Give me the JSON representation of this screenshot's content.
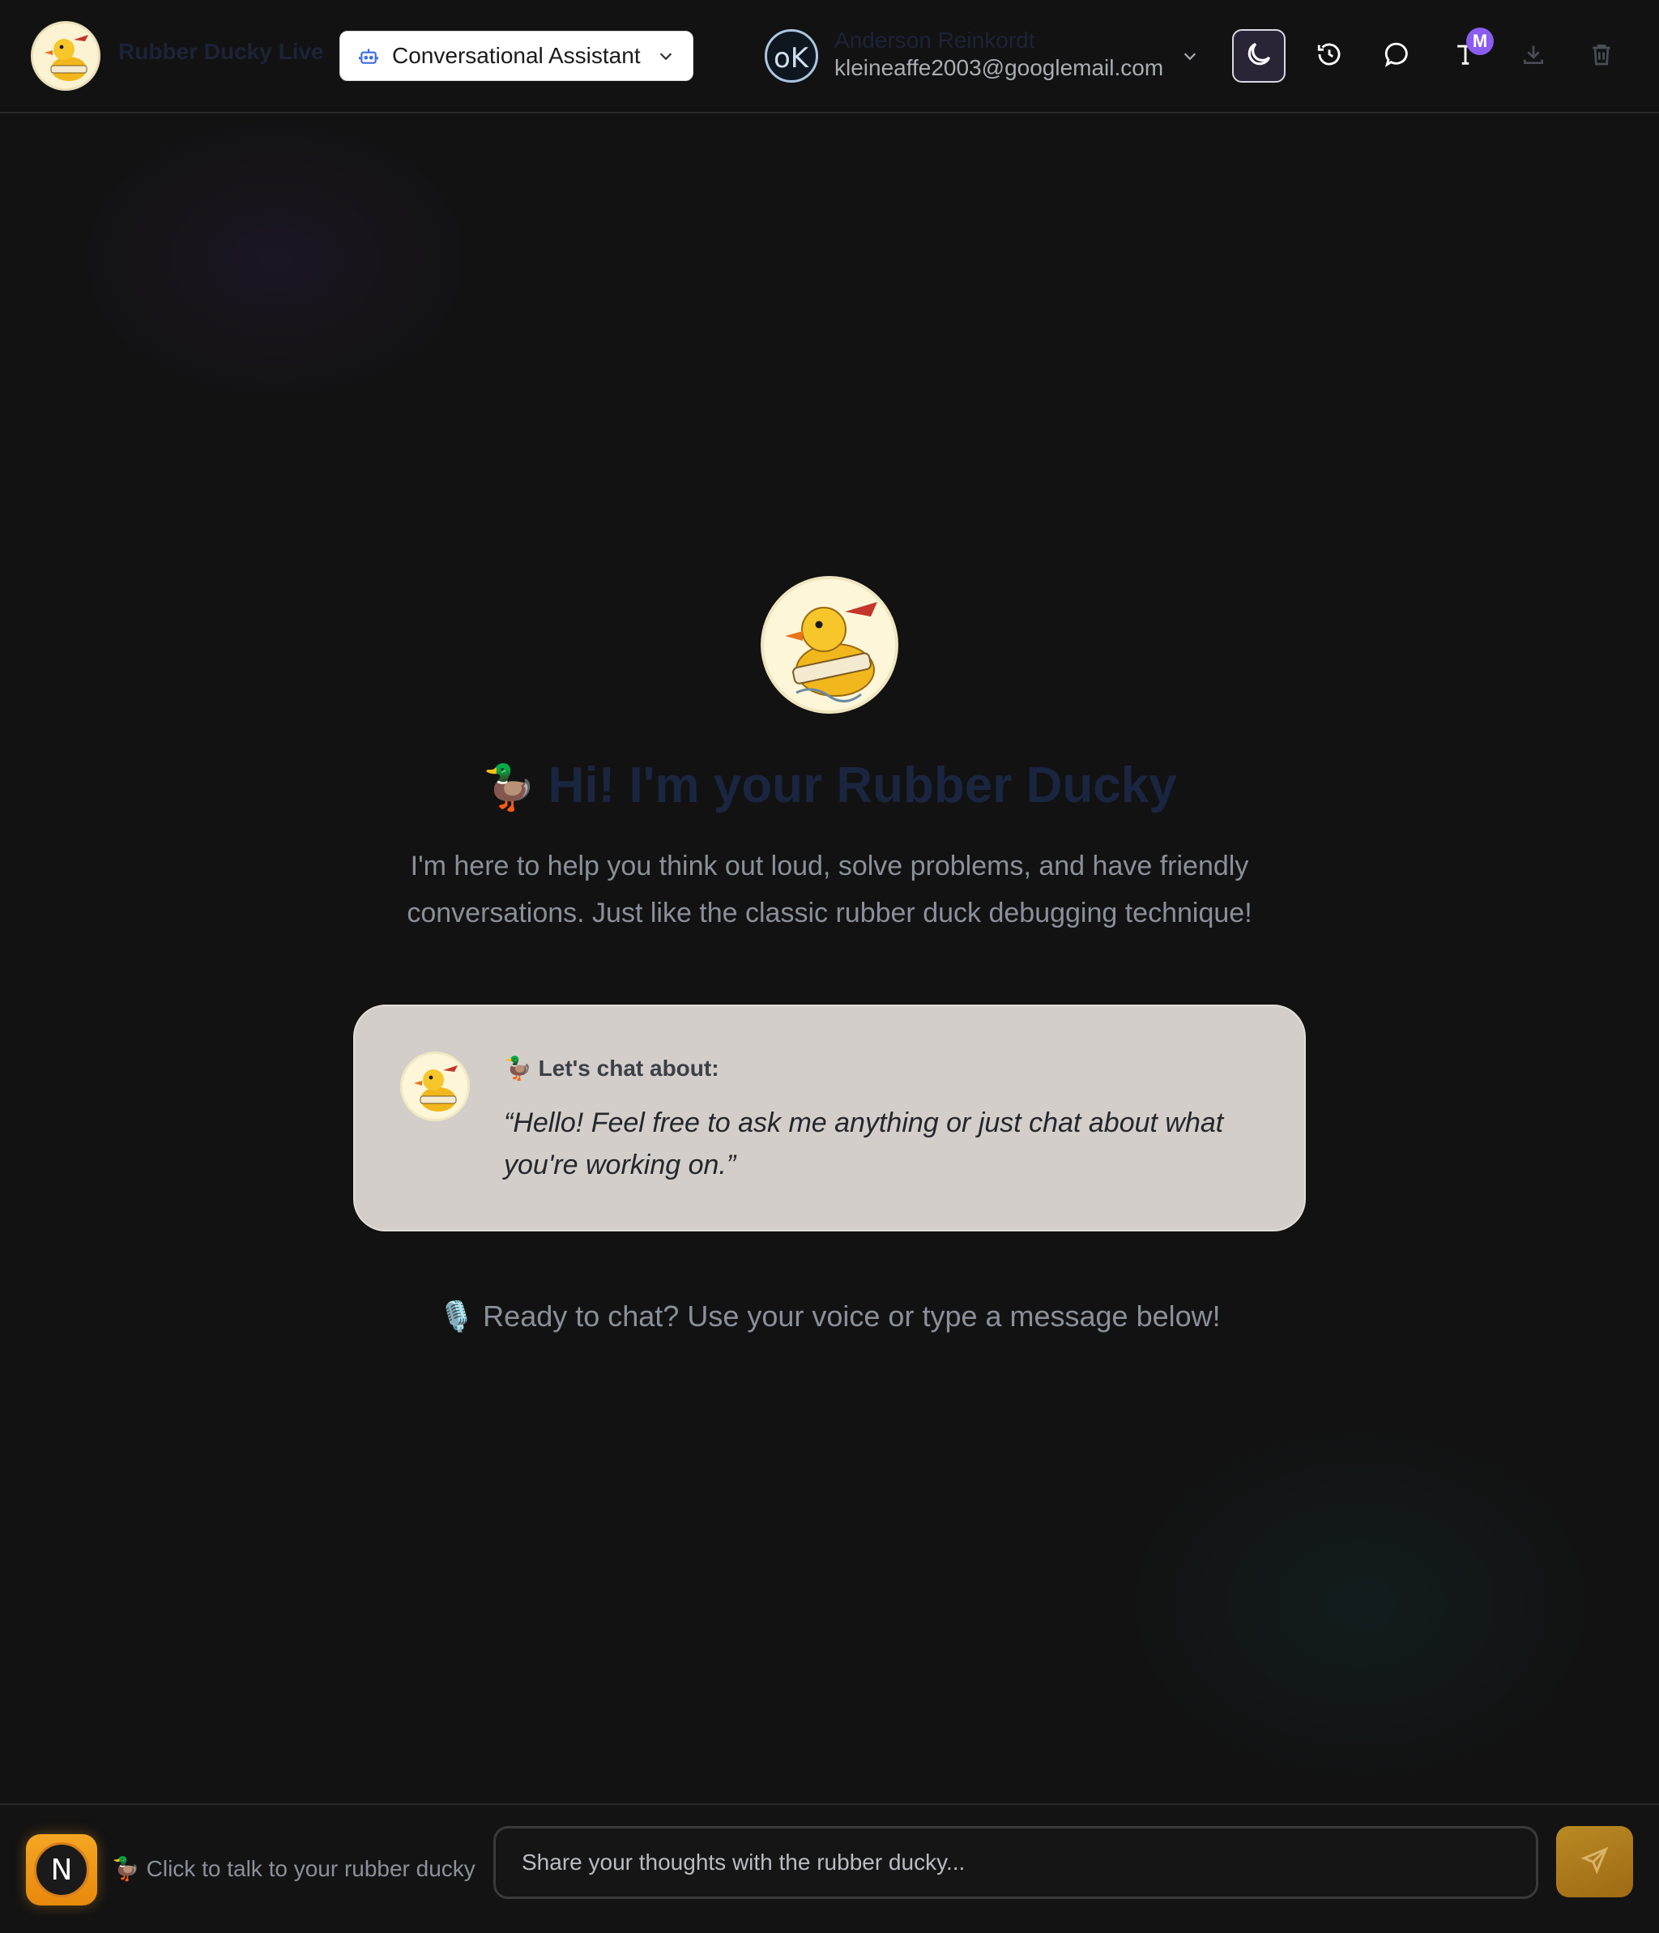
{
  "header": {
    "brand_name": "Rubber Ducky Live",
    "brand_logo_icon": "rubber-duck-logo-icon",
    "mode_select": {
      "value": "Conversational Assistant",
      "icon": "bot-icon"
    },
    "user": {
      "name": "Anderson Reinkordt",
      "email": "kleineaffe2003@googlemail.com",
      "avatar_initials": "oK"
    },
    "actions": [
      {
        "name": "theme-toggle",
        "icon": "moon-icon"
      },
      {
        "name": "history",
        "icon": "history-icon"
      },
      {
        "name": "chat",
        "icon": "chat-bubble-icon"
      },
      {
        "name": "font",
        "icon": "font-icon"
      },
      {
        "name": "download",
        "icon": "download-icon"
      },
      {
        "name": "delete",
        "icon": "trash-icon"
      }
    ],
    "font_badge": "M"
  },
  "hero": {
    "emoji": "🦆",
    "title": "Hi! I'm your Rubber Ducky",
    "subtitle": "I'm here to help you think out loud, solve problems, and have friendly conversations. Just like the classic rubber duck debugging technique!"
  },
  "card": {
    "heading": "🦆 Let's chat about:",
    "quote": "“Hello! Feel free to ask me anything or just chat about what you're working on.”"
  },
  "ready_text": "🎙️ Ready to chat? Use your voice or type a message below!",
  "bottom": {
    "mic_letter": "N",
    "talk_label": "🦆 Click to talk to your rubber ducky",
    "input_placeholder": "Share your thoughts with the rubber ducky...",
    "input_value": ""
  },
  "colors": {
    "background": "#121212",
    "accent_orange": "#f5a623",
    "send_button": "#b88a23",
    "badge_purple": "#8a5cf0",
    "card_background": "#d3cec9"
  }
}
